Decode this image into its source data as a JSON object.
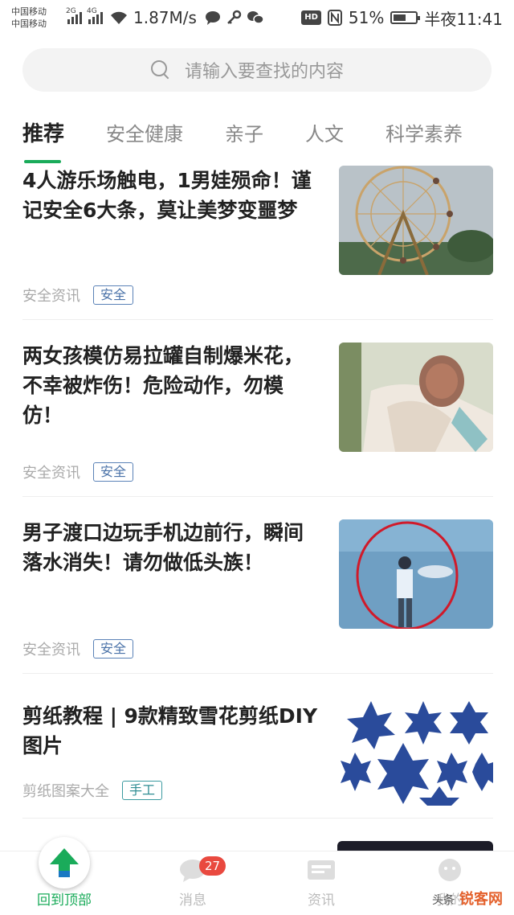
{
  "status_bar": {
    "carrier_1": "中国移动",
    "carrier_2": "中国移动",
    "network_1": "2G",
    "network_2": "4G",
    "speed": "1.87M/s",
    "battery": "51%",
    "time": "半夜11:41",
    "icons": [
      "chat-bubble-icon",
      "key-icon",
      "wechat-icon",
      "hd-icon",
      "nfc-icon",
      "battery-icon"
    ]
  },
  "search": {
    "placeholder": "请输入要查找的内容"
  },
  "tabs": [
    {
      "label": "推荐",
      "active": true
    },
    {
      "label": "安全健康",
      "active": false
    },
    {
      "label": "亲子",
      "active": false
    },
    {
      "label": "人文",
      "active": false
    },
    {
      "label": "科学素养",
      "active": false
    }
  ],
  "news": [
    {
      "title": "4人游乐场触电，1男娃殒命！谨记安全6大条，莫让美梦变噩梦",
      "source": "安全资讯",
      "tag": "安全",
      "thumb": "ferris-wheel-image"
    },
    {
      "title": "两女孩模仿易拉罐自制爆米花，不幸被炸伤！危险动作，勿模仿！",
      "source": "安全资讯",
      "tag": "安全",
      "thumb": "injured-child-image"
    },
    {
      "title": "男子渡口边玩手机边前行，瞬间落水消失！请勿做低头族！",
      "source": "安全资讯",
      "tag": "安全",
      "thumb": "man-at-water-image"
    },
    {
      "title": "剪纸教程 | 9款精致雪花剪纸DIY图片",
      "source": "剪纸图案大全",
      "tag": "手工",
      "thumb": "paper-snowflakes-image"
    }
  ],
  "bottom_nav": [
    {
      "label": "回到顶部",
      "icon": "arrow-up-icon",
      "active": true
    },
    {
      "label": "消息",
      "icon": "message-icon",
      "badge": "27"
    },
    {
      "label": "资讯",
      "icon": "news-icon"
    },
    {
      "label": "我的",
      "icon": "profile-icon"
    }
  ],
  "watermark": {
    "prefix": "头条",
    "text": "锐客网"
  },
  "colors": {
    "accent": "#1aab5a",
    "badge": "#e9493f",
    "tag_border": "#5a82b7"
  }
}
